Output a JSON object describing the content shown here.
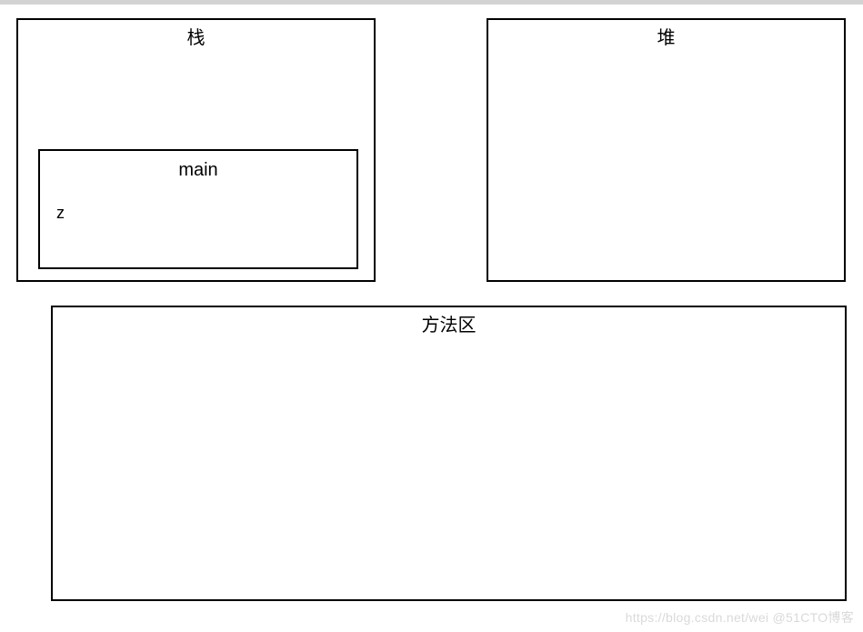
{
  "stack": {
    "title": "栈",
    "frame": {
      "name": "main",
      "variables": {
        "z": "z"
      }
    }
  },
  "heap": {
    "title": "堆"
  },
  "method_area": {
    "title": "方法区"
  },
  "watermark": "https://blog.csdn.net/wei @51CTO博客"
}
